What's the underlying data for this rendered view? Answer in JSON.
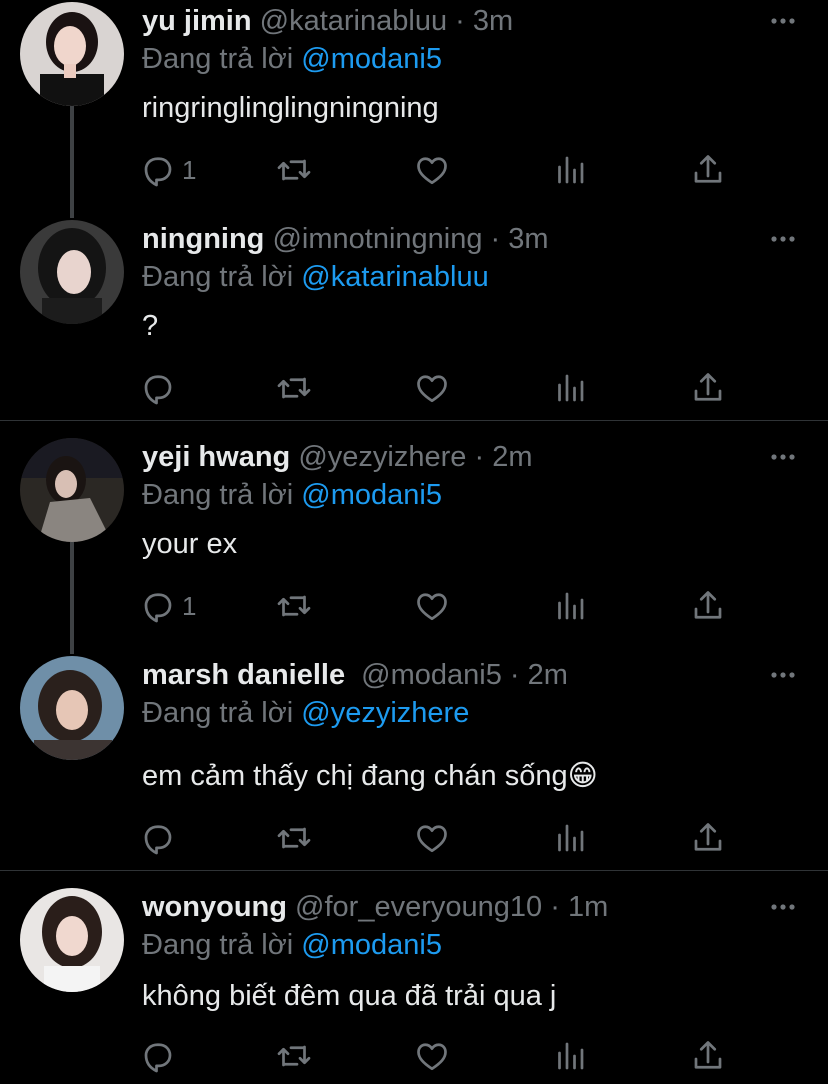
{
  "colors": {
    "background": "#000000",
    "text": "#e7e9ea",
    "secondary": "#71767b",
    "mention": "#1d9bf0",
    "divider": "#2f3336",
    "thread_line": "#3e4144"
  },
  "replying_prefix": "Đang trả lời",
  "dot": "·",
  "tweets": [
    {
      "name": "yu jimin",
      "handle": "@katarinabluu",
      "time": "3m",
      "reply_to": "@modani5",
      "text": "ringringlinglingningning",
      "reply_count": "1",
      "icons": [
        "reply-icon",
        "retweet-icon",
        "like-icon",
        "views-icon",
        "share-icon"
      ]
    },
    {
      "name": "ningning",
      "handle": "@imnotningning",
      "time": "3m",
      "reply_to": "@katarinabluu",
      "text": "?",
      "reply_count": "",
      "icons": [
        "reply-icon",
        "retweet-icon",
        "like-icon",
        "views-icon",
        "share-icon"
      ]
    },
    {
      "name": "yeji hwang",
      "handle": "@yezyizhere",
      "time": "2m",
      "reply_to": "@modani5",
      "text": "your ex",
      "reply_count": "1",
      "icons": [
        "reply-icon",
        "retweet-icon",
        "like-icon",
        "views-icon",
        "share-icon"
      ]
    },
    {
      "name": "marsh danielle",
      "handle": "@modani5",
      "time": "2m",
      "reply_to": "@yezyizhere",
      "text": "em cảm thấy chị đang chán sống😁",
      "reply_count": "",
      "icons": [
        "reply-icon",
        "retweet-icon",
        "like-icon",
        "views-icon",
        "share-icon"
      ]
    },
    {
      "name": "wonyoung",
      "handle": "@for_everyoung10",
      "time": "1m",
      "reply_to": "@modani5",
      "text": "không biết đêm qua đã trải qua j",
      "reply_count": "",
      "icons": [
        "reply-icon",
        "retweet-icon",
        "like-icon",
        "views-icon",
        "share-icon"
      ]
    }
  ]
}
